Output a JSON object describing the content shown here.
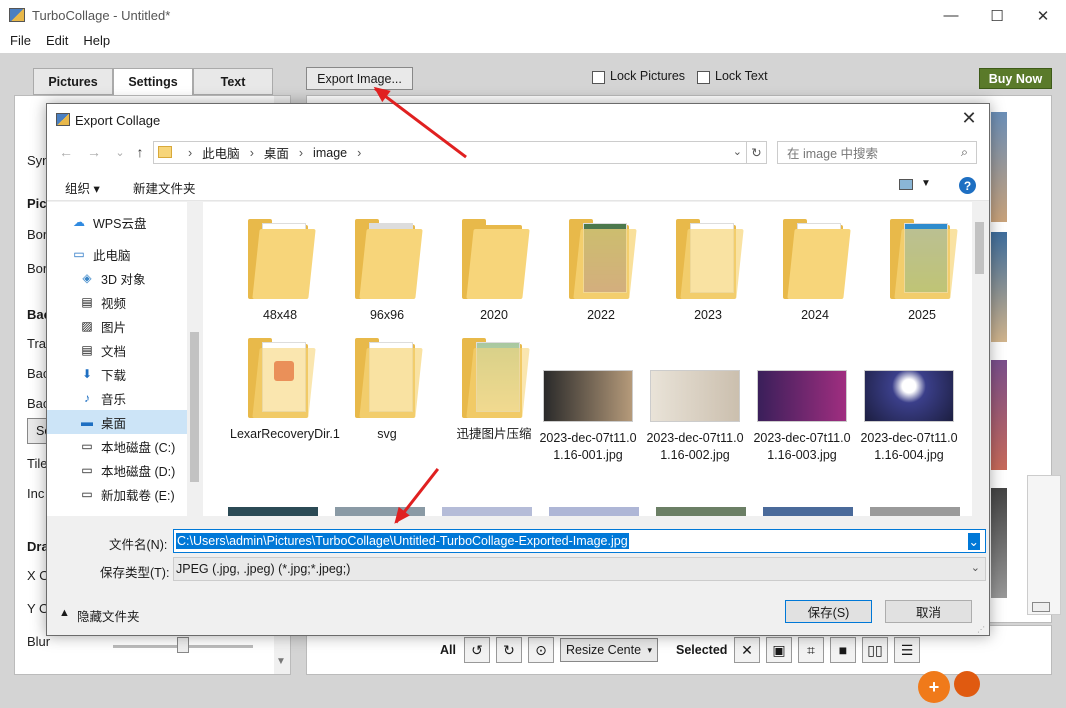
{
  "app": {
    "title": "TurboCollage - Untitled*"
  },
  "menubar": [
    "File",
    "Edit",
    "Help"
  ],
  "tabs": [
    "Pictures",
    "Settings",
    "Text"
  ],
  "toolbar": {
    "export_label": "Export Image...",
    "lock_pictures": "Lock Pictures",
    "lock_text": "Lock Text",
    "buy_now": "Buy Now"
  },
  "left_panel": {
    "labels": [
      "Syn",
      "Pic",
      "Bor",
      "Bor",
      "Bac",
      "Tra",
      "Bac",
      "Bac",
      "Se",
      "Tile",
      "Inc",
      "Dra",
      "X O",
      "Y O",
      "Blur"
    ]
  },
  "bottom_toolbar": {
    "all": "All",
    "resize": "Resize Cente",
    "selected": "Selected"
  },
  "dialog": {
    "title": "Export Collage",
    "breadcrumb": [
      "此电脑",
      "桌面",
      "image"
    ],
    "search_placeholder": "在 image 中搜索",
    "organize": "组织 ▾",
    "new_folder": "新建文件夹",
    "nav": [
      "WPS云盘",
      "此电脑",
      "3D 对象",
      "视频",
      "图片",
      "文档",
      "下载",
      "音乐",
      "桌面",
      "本地磁盘 (C:)",
      "本地磁盘 (D:)",
      "新加载卷 (E:)"
    ],
    "folders": [
      "48x48",
      "96x96",
      "2020",
      "2022",
      "2023",
      "2024",
      "2025",
      "LexarRecoveryDir.1",
      "svg",
      "迅捷图片压缩"
    ],
    "files": [
      "2023-dec-07t11.01.16-001.jpg",
      "2023-dec-07t11.01.16-002.jpg",
      "2023-dec-07t11.01.16-003.jpg",
      "2023-dec-07t11.01.16-004.jpg"
    ],
    "filename_label": "文件名(N):",
    "filename_value": "C:\\Users\\admin\\Pictures\\TurboCollage\\Untitled-TurboCollage-Exported-Image.jpg",
    "filetype_label": "保存类型(T):",
    "filetype_value": "JPEG (.jpg, .jpeg) (*.jpg;*.jpeg;)",
    "hide_folders": "隐藏文件夹",
    "save": "保存(S)",
    "cancel": "取消"
  },
  "colors": {
    "accent": "#0078d7",
    "buy_now": "#5a7a2a",
    "arrow": "#e02020",
    "folder": "#e8b94a"
  }
}
